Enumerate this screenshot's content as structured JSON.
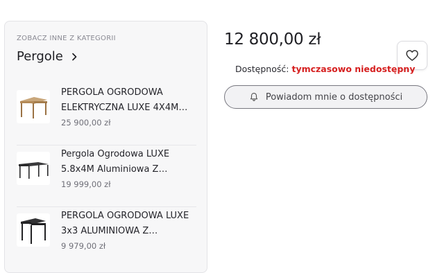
{
  "sidebar": {
    "kicker": "ZOBACZ INNE Z KATEGORII",
    "category": "Pergole",
    "products": [
      {
        "name": "PERGOLA OGRODOWA ELEKTRYCZNA LUXE 4X4M…",
        "price": "25 900,00 zł",
        "thumb_icon": "pergola-wood-icon"
      },
      {
        "name": "Pergola Ogrodowa LUXE 5.8x4M Aluminiowa Z…",
        "price": "19 999,00 zł",
        "thumb_icon": "pergola-wide-icon"
      },
      {
        "name": "PERGOLA OGRODOWA LUXE 3x3 ALUMINIOWA Z…",
        "price": "9 979,00 zł",
        "thumb_icon": "pergola-dark-icon"
      }
    ]
  },
  "product": {
    "price": "12 800,00 zł",
    "availability_label": "Dostępność:",
    "availability_status": "tymczasowo niedostępny",
    "notify_label": "Powiadom mnie o dostępności"
  },
  "colors": {
    "status_red": "#d62020",
    "border": "#e3e3e6",
    "sidebar_bg": "#f7f7f8"
  },
  "icons": {
    "favorite": "heart-icon",
    "notify": "bell-icon",
    "category_link": "chevron-right-icon"
  }
}
